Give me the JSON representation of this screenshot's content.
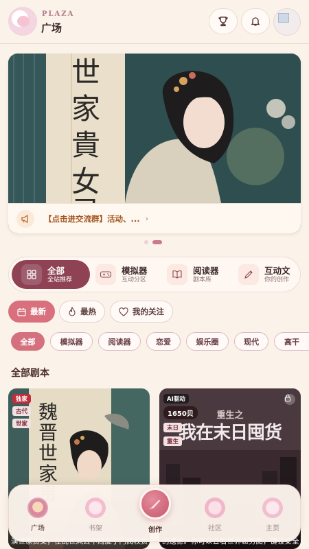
{
  "header": {
    "brand_en": "PLAZA",
    "brand_cn": "广场",
    "icons": [
      "trophy-icon",
      "bell-icon"
    ]
  },
  "banner": {
    "calligraphy": [
      "世",
      "家",
      "貴",
      "女",
      "录"
    ],
    "notice": "【点击进交流群】活动、...",
    "notice_arrow": "›",
    "slide_index": 2,
    "slide_count": 2
  },
  "categories": [
    {
      "title": "全部",
      "sub": "全站推荐",
      "icon": "grid-icon"
    },
    {
      "title": "模拟器",
      "sub": "互动分区",
      "icon": "gamepad-icon"
    },
    {
      "title": "阅读器",
      "sub": "剧本库",
      "icon": "book-icon"
    },
    {
      "title": "互动文",
      "sub": "你的创作",
      "icon": "pen-icon"
    }
  ],
  "sort_tabs": [
    "最新",
    "最热",
    "我的关注"
  ],
  "filters": [
    "全部",
    "模拟器",
    "阅读器",
    "恋爱",
    "娱乐圈",
    "现代",
    "高干"
  ],
  "section_title": "全部剧本",
  "cards": [
    {
      "badge": "独家",
      "tags": [
        "古代",
        "世家"
      ],
      "cover_title": "魏晋世家贵",
      "desc": "演世家贵女，在乱世风云中周旋于门阀权贵..."
    },
    {
      "badge": "AI驱动",
      "shells": "1650贝",
      "tags": [
        "末日",
        "重生"
      ],
      "cover_top": "重生之",
      "cover_title": "我在末日囤货",
      "desc": "的遗憾。你可以查看世界态势图，键设安全..."
    }
  ],
  "nav": {
    "items": [
      "广场",
      "书架",
      "创作",
      "社区",
      "主页"
    ],
    "active": "广场"
  },
  "colors": {
    "accent": "#8e4254",
    "pink": "#d5707f",
    "background": "#fbf3ea"
  }
}
